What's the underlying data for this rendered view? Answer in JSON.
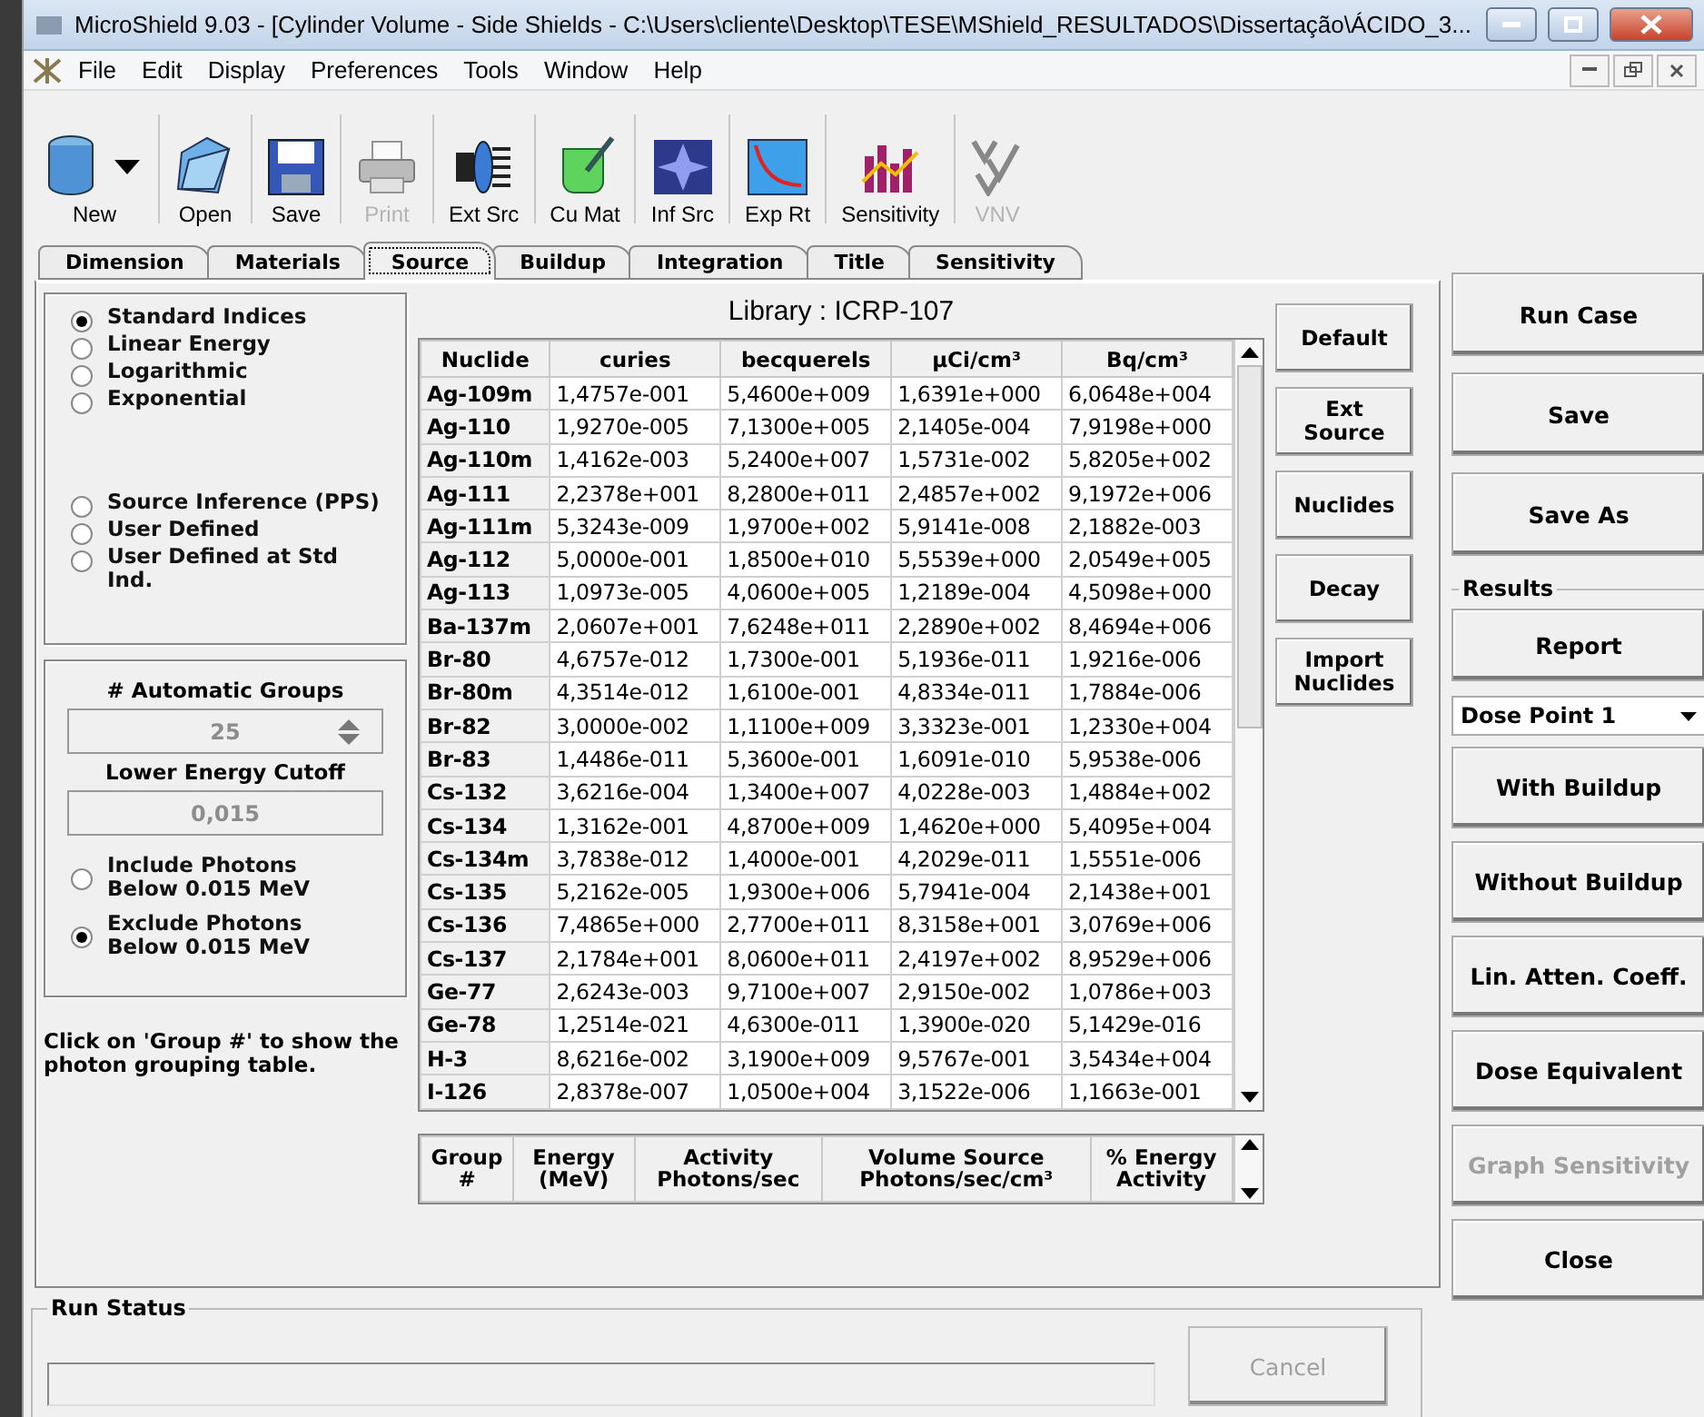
{
  "window": {
    "title": "MicroShield 9.03 - [Cylinder Volume - Side Shields - C:\\Users\\cliente\\Desktop\\TESE\\MShield_RESULTADOS\\Dissertação\\ÁCIDO_3..."
  },
  "menu": [
    "File",
    "Edit",
    "Display",
    "Preferences",
    "Tools",
    "Window",
    "Help"
  ],
  "toolbar": [
    {
      "label": "New",
      "kind": "cylinder",
      "disabled": false
    },
    {
      "label": "Open",
      "kind": "folder",
      "disabled": false
    },
    {
      "label": "Save",
      "kind": "disk",
      "disabled": false
    },
    {
      "label": "Print",
      "kind": "printer",
      "disabled": true
    },
    {
      "label": "Ext Src",
      "kind": "source",
      "disabled": false
    },
    {
      "label": "Cu Mat",
      "kind": "beaker",
      "disabled": false
    },
    {
      "label": "Inf Src",
      "kind": "star",
      "disabled": false
    },
    {
      "label": "Exp Rt",
      "kind": "curve",
      "disabled": false
    },
    {
      "label": "Sensitivity",
      "kind": "bars",
      "disabled": false
    },
    {
      "label": "VNV",
      "kind": "check",
      "disabled": true
    }
  ],
  "tabs": [
    {
      "label": "Dimension",
      "selected": false
    },
    {
      "label": "Materials",
      "selected": false
    },
    {
      "label": "Source",
      "selected": true
    },
    {
      "label": "Buildup",
      "selected": false
    },
    {
      "label": "Integration",
      "selected": false
    },
    {
      "label": "Title",
      "selected": false
    },
    {
      "label": "Sensitivity",
      "selected": false
    }
  ],
  "grouping_methods": [
    {
      "label": "Standard Indices",
      "selected": true
    },
    {
      "label": "Linear Energy",
      "selected": false
    },
    {
      "label": "Logarithmic",
      "selected": false
    },
    {
      "label": "Exponential",
      "selected": false
    },
    {
      "label": "Source Inference (PPS)",
      "selected": false,
      "gap": true
    },
    {
      "label": "User Defined",
      "selected": false
    },
    {
      "label": "User Defined at Std Ind.",
      "selected": false
    }
  ],
  "groups": {
    "label": "# Automatic Groups",
    "value": "25",
    "cutoff_label": "Lower Energy Cutoff",
    "cutoff_value": "0,015",
    "disabled": true
  },
  "photon_options": [
    {
      "label": "Include Photons Below 0.015 MeV",
      "selected": false
    },
    {
      "label": "Exclude Photons Below 0.015 MeV",
      "selected": true
    }
  ],
  "hint": "Click on 'Group #' to show the photon grouping table.",
  "library": "Library : ICRP-107",
  "nuclide_table": {
    "columns": [
      "Nuclide",
      "curies",
      "becquerels",
      "µCi/cm³",
      "Bq/cm³"
    ],
    "rows": [
      [
        "Ag-109m",
        "1,4757e-001",
        "5,4600e+009",
        "1,6391e+000",
        "6,0648e+004"
      ],
      [
        "Ag-110",
        "1,9270e-005",
        "7,1300e+005",
        "2,1405e-004",
        "7,9198e+000"
      ],
      [
        "Ag-110m",
        "1,4162e-003",
        "5,2400e+007",
        "1,5731e-002",
        "5,8205e+002"
      ],
      [
        "Ag-111",
        "2,2378e+001",
        "8,2800e+011",
        "2,4857e+002",
        "9,1972e+006"
      ],
      [
        "Ag-111m",
        "5,3243e-009",
        "1,9700e+002",
        "5,9141e-008",
        "2,1882e-003"
      ],
      [
        "Ag-112",
        "5,0000e-001",
        "1,8500e+010",
        "5,5539e+000",
        "2,0549e+005"
      ],
      [
        "Ag-113",
        "1,0973e-005",
        "4,0600e+005",
        "1,2189e-004",
        "4,5098e+000"
      ],
      [
        "Ba-137m",
        "2,0607e+001",
        "7,6248e+011",
        "2,2890e+002",
        "8,4694e+006"
      ],
      [
        "Br-80",
        "4,6757e-012",
        "1,7300e-001",
        "5,1936e-011",
        "1,9216e-006"
      ],
      [
        "Br-80m",
        "4,3514e-012",
        "1,6100e-001",
        "4,8334e-011",
        "1,7884e-006"
      ],
      [
        "Br-82",
        "3,0000e-002",
        "1,1100e+009",
        "3,3323e-001",
        "1,2330e+004"
      ],
      [
        "Br-83",
        "1,4486e-011",
        "5,3600e-001",
        "1,6091e-010",
        "5,9538e-006"
      ],
      [
        "Cs-132",
        "3,6216e-004",
        "1,3400e+007",
        "4,0228e-003",
        "1,4884e+002"
      ],
      [
        "Cs-134",
        "1,3162e-001",
        "4,8700e+009",
        "1,4620e+000",
        "5,4095e+004"
      ],
      [
        "Cs-134m",
        "3,7838e-012",
        "1,4000e-001",
        "4,2029e-011",
        "1,5551e-006"
      ],
      [
        "Cs-135",
        "5,2162e-005",
        "1,9300e+006",
        "5,7941e-004",
        "2,1438e+001"
      ],
      [
        "Cs-136",
        "7,4865e+000",
        "2,7700e+011",
        "8,3158e+001",
        "3,0769e+006"
      ],
      [
        "Cs-137",
        "2,1784e+001",
        "8,0600e+011",
        "2,4197e+002",
        "8,9529e+006"
      ],
      [
        "Ge-77",
        "2,6243e-003",
        "9,7100e+007",
        "2,9150e-002",
        "1,0786e+003"
      ],
      [
        "Ge-78",
        "1,2514e-021",
        "4,6300e-011",
        "1,3900e-020",
        "5,1429e-016"
      ],
      [
        "H-3",
        "8,6216e-002",
        "3,1900e+009",
        "9,5767e-001",
        "3,5434e+004"
      ],
      [
        "I-126",
        "2,8378e-007",
        "1,0500e+004",
        "3,1522e-006",
        "1,1663e-001"
      ]
    ]
  },
  "group_table": {
    "columns": [
      "Group #",
      "Energy (MeV)",
      "Activity Photons/sec",
      "Volume Source Photons/sec/cm³",
      "% Energy Activity"
    ]
  },
  "source_buttons": [
    "Default",
    "Ext Source",
    "Nuclides",
    "Decay",
    "Import Nuclides"
  ],
  "actions": [
    {
      "label": "Run Case",
      "disabled": false
    },
    {
      "label": "Save",
      "disabled": false
    },
    {
      "label": "Save As",
      "disabled": false
    }
  ],
  "results": {
    "label": "Results",
    "report": "Report",
    "dose_point": "Dose Point 1",
    "buttons": [
      {
        "label": "With Buildup",
        "disabled": false
      },
      {
        "label": "Without Buildup",
        "disabled": false
      },
      {
        "label": "Lin. Atten. Coeff.",
        "disabled": false
      },
      {
        "label": "Dose Equivalent",
        "disabled": false
      },
      {
        "label": "Graph Sensitivity",
        "disabled": true
      },
      {
        "label": "Close",
        "disabled": false
      }
    ]
  },
  "run_status": {
    "label": "Run Status",
    "cancel": "Cancel",
    "cancel_disabled": true
  }
}
